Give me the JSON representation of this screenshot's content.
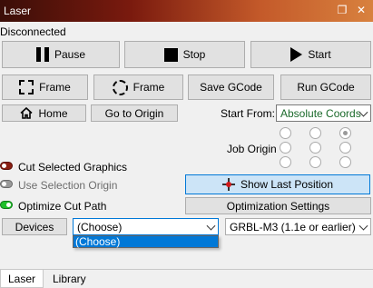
{
  "window": {
    "title": "Laser",
    "restore_icon": "restore-window-icon",
    "close_icon": "close-icon"
  },
  "status": "Disconnected",
  "controls": {
    "pause": "Pause",
    "stop": "Stop",
    "start": "Start"
  },
  "frame_row": {
    "frame_rect": "Frame",
    "frame_circle": "Frame",
    "save_gcode": "Save GCode",
    "run_gcode": "Run GCode"
  },
  "nav_row": {
    "home": "Home",
    "go_to_origin": "Go to Origin",
    "start_from_label": "Start From:",
    "start_from_value": "Absolute Coords"
  },
  "job_origin": {
    "label": "Job Origin",
    "selected_index": 2
  },
  "options": [
    {
      "label": "Cut Selected Graphics",
      "state": "off",
      "color": "#8a1e12",
      "enabled": true
    },
    {
      "label": "Use Selection Origin",
      "state": "off",
      "color": "#9a9a9a",
      "enabled": false
    },
    {
      "label": "Optimize Cut Path",
      "state": "on",
      "color": "#1fbf2a",
      "enabled": true
    }
  ],
  "show_last_position": "Show Last Position",
  "optimization_settings": "Optimization Settings",
  "devices": {
    "button": "Devices",
    "selected": "(Choose)",
    "options": [
      "(Choose)"
    ],
    "firmware": "GRBL-M3 (1.1e or earlier)"
  },
  "tabs": [
    {
      "label": "Laser",
      "active": true
    },
    {
      "label": "Library",
      "active": false
    }
  ]
}
